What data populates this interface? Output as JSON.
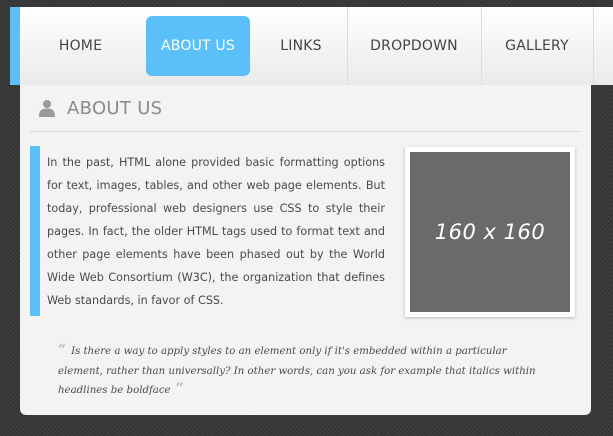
{
  "nav": {
    "items": [
      {
        "label": "HOME",
        "active": false
      },
      {
        "label": "ABOUT US",
        "active": true
      },
      {
        "label": "LINKS",
        "active": false
      },
      {
        "label": "DROPDOWN",
        "active": false
      },
      {
        "label": "GALLERY",
        "active": false
      }
    ]
  },
  "section": {
    "title": "ABOUT US",
    "icon": "user-icon"
  },
  "content": {
    "paragraph": "In the past, HTML alone provided basic formatting options for text, images, tables, and other web page elements. But today, professional web designers use CSS to style their pages. In fact, the older HTML tags used to format text and other page elements have been phased out by the World Wide Web Consortium (W3C), the organization that defines Web standards, in favor of CSS.",
    "image_placeholder": "160 x 160",
    "quote": "Is there a way to apply styles to an element only if it's embedded within a particular element, rather than universally? In other words, can you ask for example that italics within headlines be boldface",
    "quote_open_mark": "“",
    "quote_close_mark": "”"
  },
  "colors": {
    "accent": "#5bc0f8",
    "panel": "#f3f3f3",
    "background": "#3a3a3a",
    "placeholder": "#6a6a6a"
  }
}
